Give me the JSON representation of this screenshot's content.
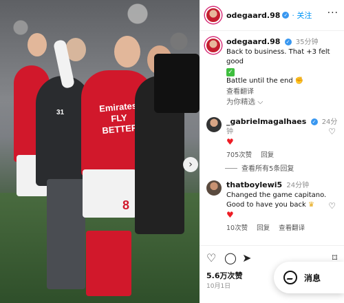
{
  "photo": {
    "shirt_sponsor": "Emirates\nFLY BETTER",
    "shirt_number": "8",
    "vest_number": "31"
  },
  "header": {
    "username": "odegaard.98",
    "follow_label": "关注",
    "more_label": "···"
  },
  "post": {
    "username": "odegaard.98",
    "time": "35分钟",
    "line1": "Back to business. That +3 felt good",
    "line2": "Battle until the end",
    "translate_label": "查看翻译"
  },
  "sort_label": "为你精选",
  "comments": [
    {
      "username": "_gabrielmagalhaes",
      "time": "24分钟",
      "text": "",
      "likes": "705次赞",
      "reply_label": "回复"
    },
    {
      "username": "thatboylewi5",
      "time": "24分钟",
      "text": "Changed the game capitano. Good to have you back",
      "likes": "10次赞",
      "reply_label": "回复",
      "translate_label": "查看翻译"
    }
  ],
  "view_replies_label": "查看所有5条回复",
  "footer": {
    "likes": "5.6万次赞",
    "date": "10月1日"
  },
  "message_button": {
    "label": "消息"
  },
  "colors": {
    "arsenal_red": "#d1182b",
    "link_blue": "#0095f6",
    "verified_blue": "#3897f0",
    "heart_red": "#ed1c24"
  }
}
